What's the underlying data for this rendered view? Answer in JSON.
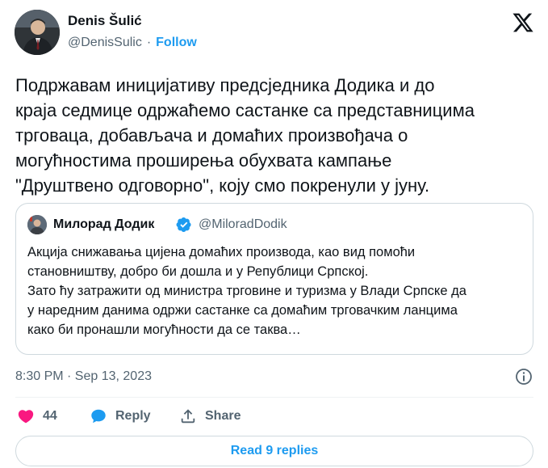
{
  "author": {
    "name": "Denis Šulić",
    "handle": "@DenisSulic",
    "separator": "·",
    "follow_label": "Follow"
  },
  "tweet": {
    "text": "Подржавам иницијативу предсједника Додика и до\nкраја седмице одржаћемо састанке са представницима\nтрговаца, добављача и домаћих произвођача о\nмогућностима проширења обухвата кампање\n\"Друштвено одговорно\", коју смо покренули у јуну.",
    "timestamp": "8:30 PM · Sep 13, 2023"
  },
  "quoted": {
    "name": "Милорад Додик",
    "handle": "@MiloradDodik",
    "text": "Акција снижавања цијена домаћих производа, као вид помоћи\nстановништву, добро би дошла и у Републици Српској.\nЗато ћу затражити од министра трговине и туризма у Влади Српске да\nу наредним данима одржи састанке са домаћим трговачким ланцима\nкако би пронашли могућности да се таква…"
  },
  "actions": {
    "like_count": "44",
    "reply_label": "Reply",
    "share_label": "Share"
  },
  "read_replies_label": "Read 9 replies",
  "colors": {
    "accent": "#1d9bf0",
    "like": "#f91880",
    "secondary_text": "#536471",
    "border": "#cfd9de"
  },
  "icons": [
    "x-logo-icon",
    "verified-badge-icon",
    "info-icon",
    "heart-icon",
    "reply-bubble-icon",
    "share-icon"
  ]
}
